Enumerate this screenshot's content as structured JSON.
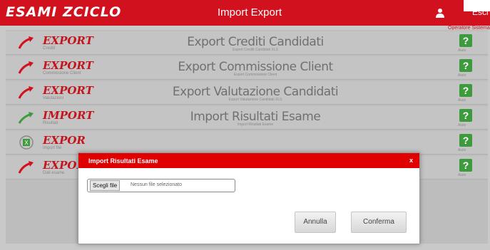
{
  "header": {
    "logo": "ESAMI ZCICLO",
    "title": "Import Export",
    "exit_label": "Esci",
    "user_sub": "Operatore Sistema"
  },
  "rows": [
    {
      "kind": "EXPORT",
      "sub": "Crediti",
      "title": "Export Crediti Candidati",
      "desc": "Export Crediti Candidati XLS",
      "help_label": "Aiuto",
      "icon": "export-arrow-icon"
    },
    {
      "kind": "EXPORT",
      "sub": "Commissione Client",
      "title": "Export Commissione Client",
      "desc": "Export Commissione Client",
      "help_label": "Aiuto",
      "icon": "export-arrow-icon"
    },
    {
      "kind": "EXPORT",
      "sub": "Valutazioni",
      "title": "Export Valutazione Candidati",
      "desc": "Export Valutazione Candidati XLS",
      "help_label": "Aiuto",
      "icon": "export-arrow-icon"
    },
    {
      "kind": "IMPORT",
      "sub": "Risultati",
      "title": "Import Risultati Esame",
      "desc": "Import Risultati Esame",
      "help_label": "Aiuto",
      "icon": "import-arrow-icon"
    },
    {
      "kind": "EXPOR",
      "sub": "Import file",
      "title": "",
      "desc": "",
      "help_label": "Aiuto",
      "icon": "excel-icon"
    },
    {
      "kind": "EXPOR",
      "sub": "Dati esame",
      "title": "",
      "desc": "",
      "help_label": "Aiuto",
      "icon": "export-arrow-icon"
    }
  ],
  "modal": {
    "title": "Import Risultati Esame",
    "close": "x",
    "file_button": "Scegli file",
    "file_placeholder": "Nessun file selezionato",
    "cancel": "Annulla",
    "confirm": "Conferma"
  },
  "colors": {
    "brand": "#d2111f",
    "help": "#3d9a3d"
  }
}
